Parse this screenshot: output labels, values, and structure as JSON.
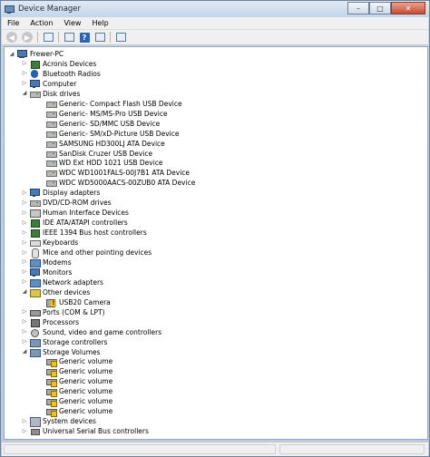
{
  "window": {
    "title": "Device Manager"
  },
  "menu": [
    "File",
    "Action",
    "View",
    "Help"
  ],
  "toolbar": {
    "back_icon": "back-arrow-icon",
    "forward_icon": "forward-arrow-icon",
    "properties_icon": "properties-icon",
    "help_icon": "help-icon",
    "scan_icon": "scan-hardware-icon"
  },
  "tree": [
    {
      "label": "Frewer-PC",
      "level": 0,
      "expanded": true,
      "icon": "pc"
    },
    {
      "label": "Acronis Devices",
      "level": 1,
      "expanded": false,
      "icon": "chip"
    },
    {
      "label": "Bluetooth Radios",
      "level": 1,
      "expanded": false,
      "icon": "bt"
    },
    {
      "label": "Computer",
      "level": 1,
      "expanded": false,
      "icon": "monitor"
    },
    {
      "label": "Disk drives",
      "level": 1,
      "expanded": true,
      "icon": "disk"
    },
    {
      "label": "Generic- Compact Flash USB Device",
      "level": 2,
      "icon": "disk"
    },
    {
      "label": "Generic- MS/MS-Pro USB Device",
      "level": 2,
      "icon": "disk"
    },
    {
      "label": "Generic- SD/MMC USB Device",
      "level": 2,
      "icon": "disk"
    },
    {
      "label": "Generic- SM/xD-Picture USB Device",
      "level": 2,
      "icon": "disk"
    },
    {
      "label": "SAMSUNG HD300LJ ATA Device",
      "level": 2,
      "icon": "disk"
    },
    {
      "label": "SanDisk Cruzer USB Device",
      "level": 2,
      "icon": "disk"
    },
    {
      "label": "WD Ext HDD 1021 USB Device",
      "level": 2,
      "icon": "disk"
    },
    {
      "label": "WDC WD1001FALS-00J7B1 ATA Device",
      "level": 2,
      "icon": "disk"
    },
    {
      "label": "WDC WD5000AACS-00ZUB0 ATA Device",
      "level": 2,
      "icon": "disk"
    },
    {
      "label": "Display adapters",
      "level": 1,
      "expanded": false,
      "icon": "monitor"
    },
    {
      "label": "DVD/CD-ROM drives",
      "level": 1,
      "expanded": false,
      "icon": "disk"
    },
    {
      "label": "Human Interface Devices",
      "level": 1,
      "expanded": false,
      "icon": "hid"
    },
    {
      "label": "IDE ATA/ATAPI controllers",
      "level": 1,
      "expanded": false,
      "icon": "chip"
    },
    {
      "label": "IEEE 1394 Bus host controllers",
      "level": 1,
      "expanded": false,
      "icon": "chip"
    },
    {
      "label": "Keyboards",
      "level": 1,
      "expanded": false,
      "icon": "keyb"
    },
    {
      "label": "Mice and other pointing devices",
      "level": 1,
      "expanded": false,
      "icon": "mouse"
    },
    {
      "label": "Modems",
      "level": 1,
      "expanded": false,
      "icon": "net"
    },
    {
      "label": "Monitors",
      "level": 1,
      "expanded": false,
      "icon": "monitor"
    },
    {
      "label": "Network adapters",
      "level": 1,
      "expanded": false,
      "icon": "net"
    },
    {
      "label": "Other devices",
      "level": 1,
      "expanded": true,
      "icon": "other"
    },
    {
      "label": "USB20 Camera",
      "level": 2,
      "icon": "cam"
    },
    {
      "label": "Ports (COM & LPT)",
      "level": 1,
      "expanded": false,
      "icon": "port"
    },
    {
      "label": "Processors",
      "level": 1,
      "expanded": false,
      "icon": "cpu"
    },
    {
      "label": "Sound, video and game controllers",
      "level": 1,
      "expanded": false,
      "icon": "sound"
    },
    {
      "label": "Storage controllers",
      "level": 1,
      "expanded": false,
      "icon": "storage"
    },
    {
      "label": "Storage Volumes",
      "level": 1,
      "expanded": true,
      "icon": "storage"
    },
    {
      "label": "Generic volume",
      "level": 2,
      "icon": "vol"
    },
    {
      "label": "Generic volume",
      "level": 2,
      "icon": "vol"
    },
    {
      "label": "Generic volume",
      "level": 2,
      "icon": "vol"
    },
    {
      "label": "Generic volume",
      "level": 2,
      "icon": "vol"
    },
    {
      "label": "Generic volume",
      "level": 2,
      "icon": "vol"
    },
    {
      "label": "Generic volume",
      "level": 2,
      "icon": "vol"
    },
    {
      "label": "System devices",
      "level": 1,
      "expanded": false,
      "icon": "sys"
    },
    {
      "label": "Universal Serial Bus controllers",
      "level": 1,
      "expanded": false,
      "icon": "usb"
    }
  ]
}
